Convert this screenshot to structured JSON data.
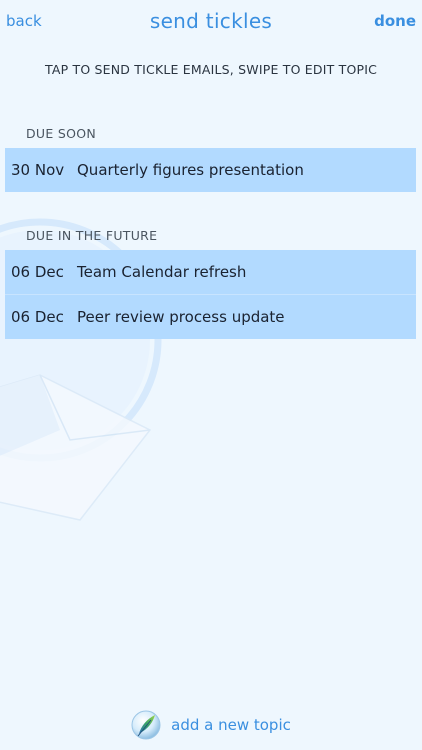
{
  "nav": {
    "back_label": "back",
    "title": "send tickles",
    "done_label": "done"
  },
  "instructions": "TAP TO SEND TICKLE EMAILS, SWIPE TO EDIT TOPIC",
  "sections": [
    {
      "header": "DUE SOON",
      "items": [
        {
          "date": "30 Nov",
          "topic": "Quarterly figures presentation"
        }
      ]
    },
    {
      "header": "DUE IN THE FUTURE",
      "items": [
        {
          "date": "06 Dec",
          "topic": "Team Calendar refresh"
        },
        {
          "date": "06 Dec",
          "topic": "Peer review process update"
        }
      ]
    }
  ],
  "footer": {
    "icon": "feather-icon",
    "label": "add a new topic"
  },
  "colors": {
    "accent": "#3a8fe0",
    "row_background": "#b2daff",
    "page_background": "#eef7fe"
  }
}
